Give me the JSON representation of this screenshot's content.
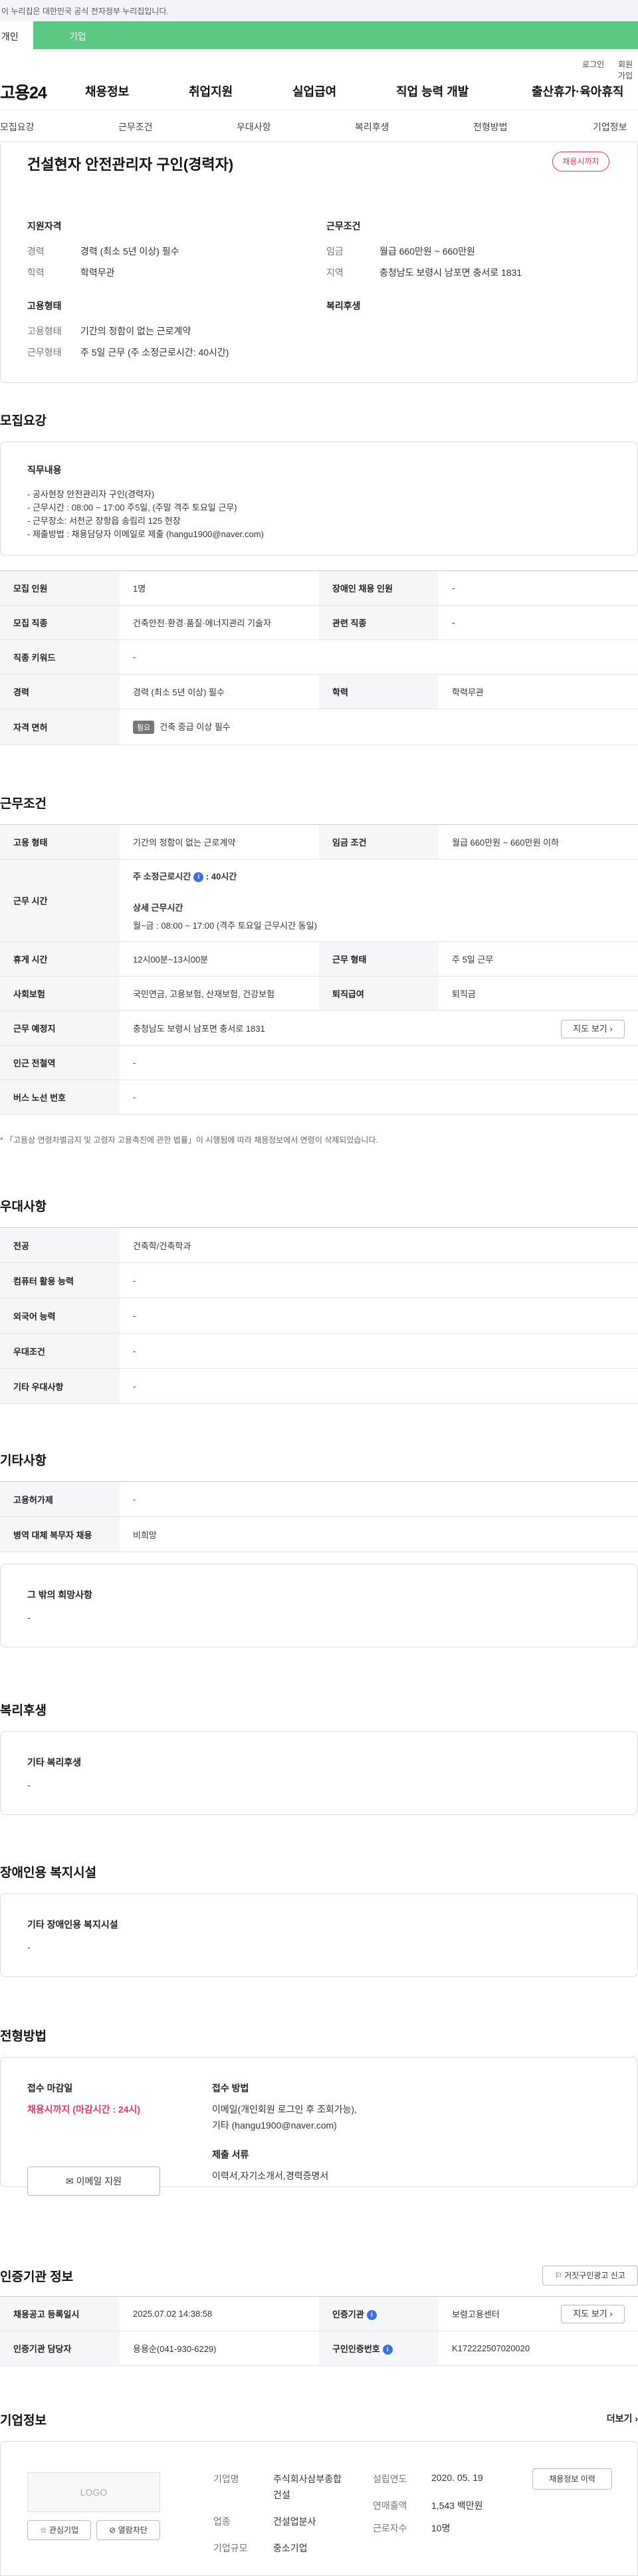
{
  "gov_banner": "이 누리집은 대한민국 공식 전자정부 누리집입니다.",
  "tabs": {
    "personal": "개인",
    "company": "기업"
  },
  "util": {
    "login": "로그인",
    "join": "회원가입"
  },
  "gnb": {
    "logo": "고용24",
    "menu": [
      "채용정보",
      "취업지원",
      "실업급여",
      "직업 능력 개발",
      "출산휴가·육아휴직"
    ]
  },
  "anchor": [
    "모집요강",
    "근무조건",
    "우대사항",
    "복리후생",
    "전형방법",
    "기업정보"
  ],
  "summary": {
    "title": "건설현자 안전관리자 구인(경력자)",
    "status": "채용시까지",
    "qual_title": "지원자격",
    "cond_title": "근무조건",
    "emp_title": "고용형태",
    "welfare_title": "복리후생",
    "career_k": "경력",
    "career_v": "경력 (최소 5년 이상) 필수",
    "edu_k": "학력",
    "edu_v": "학력무관",
    "wage_k": "임금",
    "wage_v": "월급 660만원 ~ 660만원",
    "region_k": "지역",
    "region_v": "충청남도 보령시 남포면 충서로 1831",
    "emptype_k": "고용형태",
    "emptype_v": "기간의 정함이 없는 근로계약",
    "worktype_k": "근무형태",
    "worktype_v": "주 5일 근무 (주 소정근로시간: 40시간)"
  },
  "recruit": {
    "section": "모집요강",
    "duty_title": "직무내용",
    "duty_lines": [
      "- 공사현장 안전관리자 구인(경력자)",
      "- 근무시간 : 08:00 ~ 17:00 주5일, (주말 격주 토요일 근무)",
      "- 근무장소: 서천군 장항읍 송림리 125 현장",
      "- 제출방법 : 채용담당자 이메일로 제출 (hangu1900@naver.com)"
    ],
    "rows": [
      [
        "모집 인원",
        "1명",
        "장애인 채용 인원",
        "-"
      ],
      [
        "모집 직종",
        "건축안전·환경·품질·에너지관리 기술자",
        "관련 직종",
        "-"
      ],
      [
        "직종 키워드",
        "-"
      ],
      [
        "경력",
        "경력 (최소 5년 이상) 필수",
        "학력",
        "학력무관"
      ]
    ],
    "license_k": "자격 면허",
    "license_badge": "필요",
    "license_v": "건축 중급 이상 필수"
  },
  "work": {
    "section": "근무조건",
    "emptype_k": "고용 형태",
    "emptype_v": "기간의 정함이 없는 근로계약",
    "wage_k": "임금 조건",
    "wage_v": "월급 660만원 ~ 660만원 이하",
    "hours_k": "근무 시간",
    "hours_main": "주 소정근로시간",
    "hours_num": "40시간",
    "hours_detail_t": "상세 근무시간",
    "hours_detail_v": "월~금 : 08:00 ~ 17:00 (격주 토요일 근무시간 동일)",
    "rest_k": "휴게 시간",
    "rest_v": "12시00분~13시00분",
    "form_k": "근무 형태",
    "form_v": "주 5일 근무",
    "ins_k": "사회보험",
    "ins_v": "국민연금, 고용보험, 산재보험, 건강보험",
    "ret_k": "퇴직급여",
    "ret_v": "퇴직금",
    "place_k": "근무 예정지",
    "place_v": "충청남도 보령시 남포면 충서로 1831",
    "map_btn": "지도 보기",
    "subway_k": "인근 전철역",
    "subway_v": "-",
    "bus_k": "버스 노선 번호",
    "bus_v": "-",
    "note": "* 「고용상 연령차별금지 및 고령자 고용촉진에 관한 법률」이 시행됨에 따라 채용정보에서 연령이 삭제되었습니다."
  },
  "pref": {
    "section": "우대사항",
    "rows": [
      [
        "전공",
        "건축학/건축학과"
      ],
      [
        "컴퓨터 활용 능력",
        "-"
      ],
      [
        "외국어 능력",
        "-"
      ],
      [
        "우대조건",
        "-"
      ],
      [
        "기타 우대사항",
        "-"
      ]
    ]
  },
  "etc": {
    "section": "기타사항",
    "rows": [
      [
        "고용허가제",
        "-"
      ],
      [
        "병역 대체 복무자 채용",
        "비희망"
      ]
    ],
    "box_t": "그 밖의 희망사항",
    "box_v": "-"
  },
  "welfare": {
    "section": "복리후생",
    "box_t": "기타 복리후생",
    "box_v": "-"
  },
  "disabled": {
    "section": "장애인용 복지시설",
    "box_t": "기타 장애인용 복지시설",
    "box_v": "-"
  },
  "apply": {
    "section": "전형방법",
    "deadline_t": "접수 마감일",
    "deadline_v": "채용시까지 (마감시간 : 24시)",
    "email_btn": "이메일 지원",
    "method_t": "접수 방법",
    "method_v1": "이메일(개인회원 로그인 후 조회가능),",
    "method_v2": "기타 (hangu1900@naver.com)",
    "docs_t": "제출 서류",
    "docs_v": "이력서,자기소개서,경력증명서"
  },
  "cert": {
    "section": "인증기관 정보",
    "report_btn": "거짓구인광고 신고",
    "reg_k": "채용공고 등록일시",
    "reg_v": "2025.07.02 14:38:58",
    "org_k": "인증기관",
    "org_v": "보령고용센터",
    "map_btn": "지도 보기",
    "mgr_k": "인증기관 담당자",
    "mgr_v": "용용순(041-930-6229)",
    "num_k": "구인인증번호",
    "num_v": "K172222507020020"
  },
  "company": {
    "section": "기업정보",
    "more": "더보기",
    "logo": "LOGO",
    "fav_btn": "관심기업",
    "block_btn": "열람차단",
    "name_k": "기업명",
    "name_v1": "주식회사삼부종합",
    "name_v2": "건설",
    "ind_k": "업종",
    "ind_v": "건설업분사",
    "size_k": "기업규모",
    "size_v": "중소기업",
    "year_k": "설립연도",
    "year_v": "2020. 05. 19",
    "sales_k": "연매출액",
    "sales_v": "1,543 백만원",
    "emp_k": "근로자수",
    "emp_v": "10명",
    "hist_btn": "채용정보 이력"
  }
}
